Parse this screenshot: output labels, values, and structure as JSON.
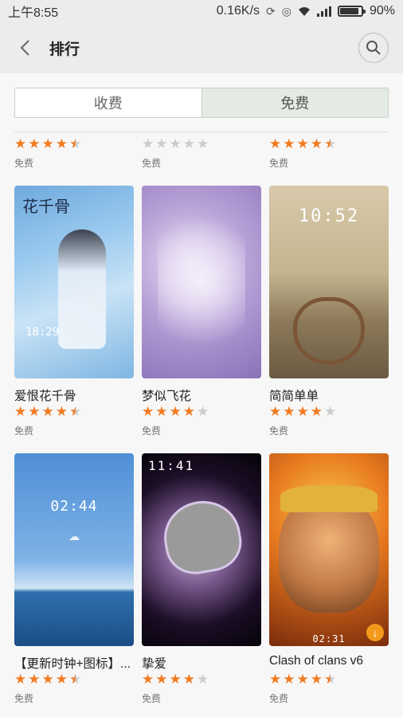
{
  "status_bar": {
    "time": "上午8:55",
    "speed": "0.16K/s",
    "battery": "90%",
    "battery_level": 0.9
  },
  "header": {
    "title": "排行"
  },
  "tabs": [
    {
      "label": "收费"
    },
    {
      "label": "免费"
    }
  ],
  "items": [
    {
      "name": "爱恨花千骨",
      "rating": 4.5,
      "price": "免费"
    },
    {
      "name": "梦似飞花",
      "rating": 4,
      "price": "免费"
    },
    {
      "name": "简简单单",
      "rating": 4,
      "price": "免费"
    },
    {
      "name": "【更新时钟+图标】...",
      "rating": 4.5,
      "price": "免费"
    },
    {
      "name": "挚爱",
      "rating": 4,
      "price": "免费"
    },
    {
      "name": "Clash of clans v6",
      "rating": 4.5,
      "price": "免费"
    }
  ],
  "partial_row": [
    {
      "rating": 4.5,
      "price": "免费"
    },
    {
      "rating": 0,
      "price": "免费"
    },
    {
      "rating": 4.5,
      "price": "免费"
    }
  ],
  "thumb_text": {
    "t1_clock": "18:29",
    "t1_title": "花千骨",
    "t3_clock": "10:52",
    "t4_clock": "02:44",
    "t5_clock": "11:41",
    "t6_clock": "02:31"
  }
}
